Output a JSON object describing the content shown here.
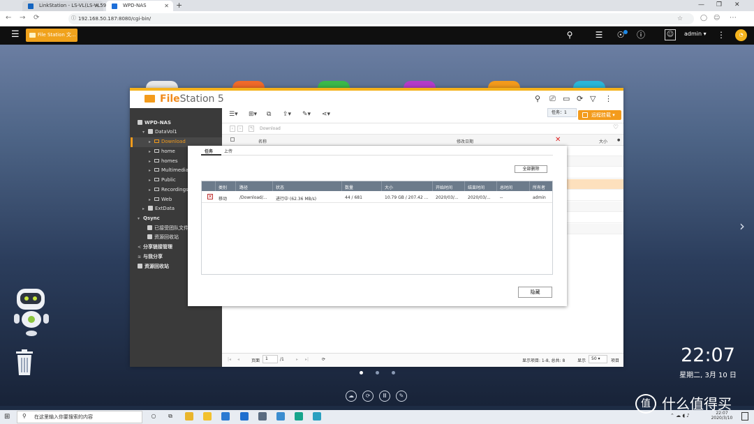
{
  "browser": {
    "tabs": [
      {
        "label": "LinkStation - LS-VL(LS-VL59",
        "active": false
      },
      {
        "label": "WPD-NAS",
        "active": true
      }
    ],
    "url": "192.168.50.187:8080/cgi-bin/"
  },
  "nas": {
    "open_app_tab": "File Station 文...",
    "user": "admin ▾",
    "notification_count": "1",
    "dashboard_label": "..."
  },
  "file_station": {
    "title_brand": "File",
    "title_rest": "Station ",
    "title_version": "5",
    "task_tip": "任务：1",
    "remote_mount": "远程挂载 ▾",
    "breadcrumb": "Download",
    "columns": {
      "name": "名称",
      "modified": "修改日期",
      "size": "大小"
    },
    "sidebar": {
      "root": "WPD-NAS",
      "volume": "DataVol1",
      "folders": [
        "Download",
        "home",
        "homes",
        "Multimedia",
        "Public",
        "Recordings",
        "Web"
      ],
      "extdata": "ExtData",
      "qsync": "Qsync",
      "qsync_items": [
        "已接受团队文件夹",
        "资源回收站"
      ],
      "share_links": "分享链接管理",
      "shared_with_me": "与我分享",
      "recycle_bin": "资源回收站"
    },
    "pager": {
      "page_label": "页面",
      "page_value": "1",
      "page_total": "/1",
      "items_shown": "显示项目: 1-8, 总共: 8",
      "show_label": "显示",
      "per_page": "50",
      "items_suffix": "项目"
    }
  },
  "task_dialog": {
    "tabs": [
      "任务",
      "上传"
    ],
    "delete_all": "全部删除",
    "hide": "隐藏",
    "headers": [
      "类别",
      "路径",
      "状态",
      "数量",
      "大小",
      "开始时间",
      "结束时间",
      "总时间",
      "所有者"
    ],
    "row": [
      "移动",
      "/Download/...",
      "进行中 (62.36 MB/s)",
      "44 / 681",
      "10.79 GB / 207.42 ...",
      "2020/03/...",
      "2020/03/...",
      "--",
      "admin"
    ]
  },
  "desktop": {
    "time": "22:07",
    "date": "星期二, 3月 10 日"
  },
  "taskbar": {
    "search_placeholder": "在这里输入你要搜索的内容",
    "tray_time": "22:07",
    "tray_date": "2020/3/10"
  },
  "watermark": "什么值得买",
  "colors": {
    "accent": "#f39b1c",
    "nasbar": "#0f0f0f",
    "sidebar": "#3a3a3a",
    "table_header": "#6c7b8b"
  }
}
